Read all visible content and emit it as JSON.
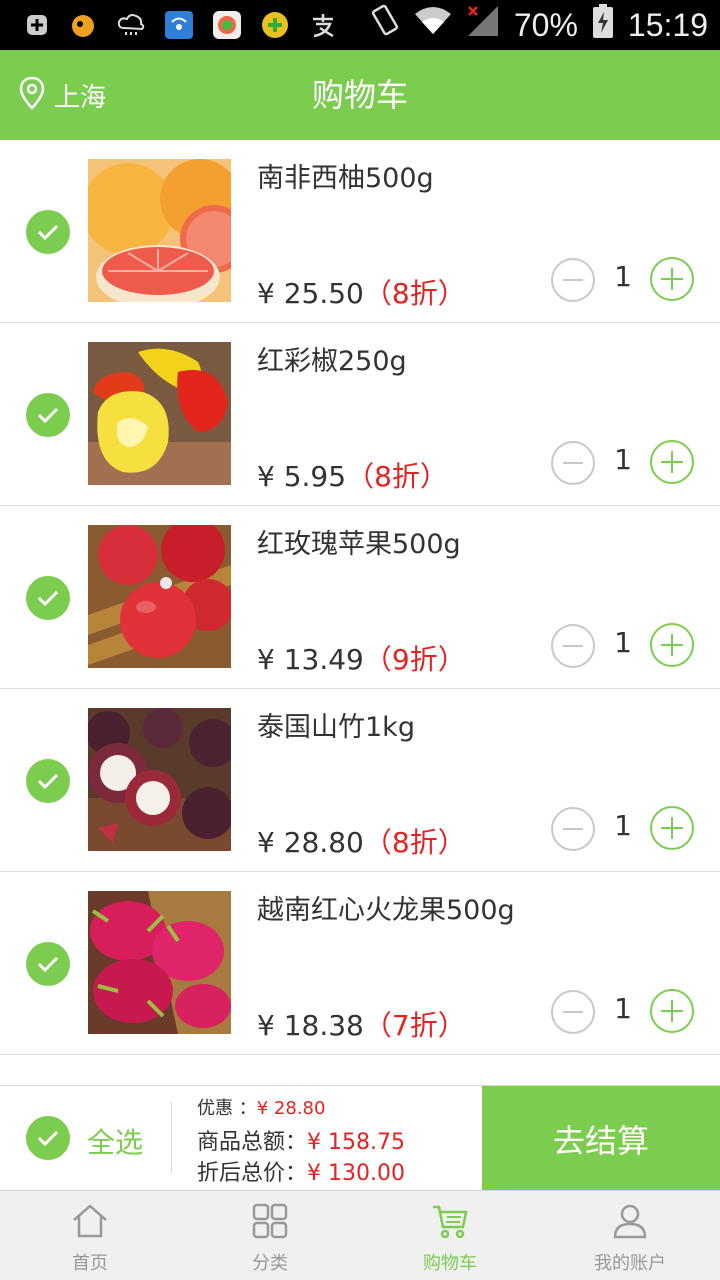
{
  "status_bar": {
    "battery": "70%",
    "time": "15:19",
    "icons": [
      "add-icon",
      "uc-browser-icon",
      "cloud-icon",
      "wifi-app-icon",
      "app-icon",
      "app-icon",
      "alipay-icon",
      "rotate-icon",
      "wifi-icon",
      "signal-icon",
      "battery-icon"
    ]
  },
  "header": {
    "location": "上海",
    "title": "购物车"
  },
  "cart": {
    "items": [
      {
        "name": "南非西柚500g",
        "price": "¥ 25.50",
        "discount": "（8折）",
        "qty": "1",
        "image": "grapefruit"
      },
      {
        "name": "红彩椒250g",
        "price": "¥ 5.95",
        "discount": "（8折）",
        "qty": "1",
        "image": "bell-pepper"
      },
      {
        "name": "红玫瑰苹果500g",
        "price": "¥ 13.49",
        "discount": "（9折）",
        "qty": "1",
        "image": "apple"
      },
      {
        "name": "泰国山竹1kg",
        "price": "¥ 28.80",
        "discount": "（8折）",
        "qty": "1",
        "image": "mangosteen"
      },
      {
        "name": "越南红心火龙果500g",
        "price": "¥ 18.38",
        "discount": "（7折）",
        "qty": "1",
        "image": "dragon-fruit"
      }
    ]
  },
  "summary": {
    "select_all": "全选",
    "discount_label": "优惠 ：",
    "discount_value": "¥ 28.80",
    "total_label": "商品总额：",
    "total_value": "¥ 158.75",
    "after_label": "折后总价：",
    "after_value": "¥ 130.00",
    "checkout": "去结算"
  },
  "tabs": [
    {
      "label": "首页",
      "icon": "home-icon",
      "active": false
    },
    {
      "label": "分类",
      "icon": "category-icon",
      "active": false
    },
    {
      "label": "购物车",
      "icon": "cart-icon",
      "active": true
    },
    {
      "label": "我的账户",
      "icon": "user-icon",
      "active": false
    }
  ],
  "colors": {
    "brand": "#7ccc4f",
    "discount": "#e52222",
    "text": "#333333"
  }
}
